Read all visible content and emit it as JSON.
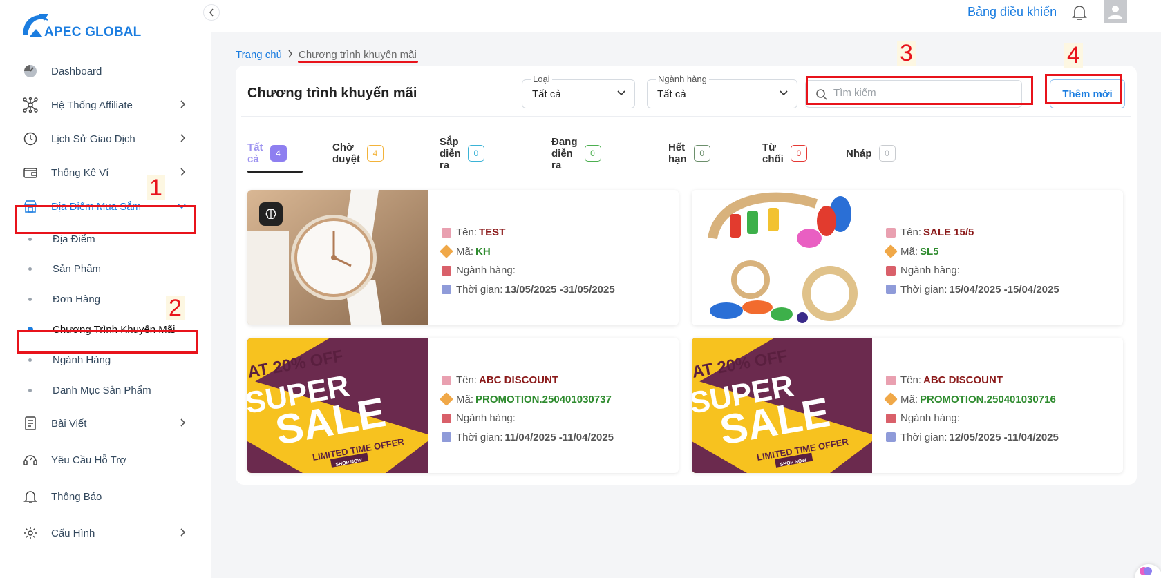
{
  "brand": {
    "name": "APEC GLOBAL"
  },
  "sidebar": {
    "items": [
      {
        "label": "Dashboard",
        "icon": "gauge-icon"
      },
      {
        "label": "Hệ Thống Affiliate",
        "icon": "network-icon"
      },
      {
        "label": "Lịch Sử Giao Dịch",
        "icon": "history-icon"
      },
      {
        "label": "Thống Kê Ví",
        "icon": "wallet-icon"
      },
      {
        "label": "Địa Điểm Mua Sắm",
        "icon": "store-icon"
      },
      {
        "label": "Bài Viết",
        "icon": "article-icon"
      },
      {
        "label": "Yêu Cầu Hỗ Trợ",
        "icon": "support-icon"
      },
      {
        "label": "Thông Báo",
        "icon": "bell-icon"
      },
      {
        "label": "Cấu Hình",
        "icon": "gear-icon"
      }
    ],
    "subitems": [
      {
        "label": "Địa Điểm"
      },
      {
        "label": "Sản Phẩm"
      },
      {
        "label": "Đơn Hàng"
      },
      {
        "label": "Chương Trình Khuyến Mãi"
      },
      {
        "label": "Ngành Hàng"
      },
      {
        "label": "Danh Mục Sản Phẩm"
      }
    ]
  },
  "annotations": {
    "n1": "1",
    "n2": "2",
    "n3": "3",
    "n4": "4"
  },
  "topbar": {
    "dashboard_link": "Bảng điều khiển"
  },
  "breadcrumb": {
    "home": "Trang chủ",
    "current": "Chương trình khuyến mãi"
  },
  "main": {
    "title": "Chương trình khuyến mãi",
    "filter_type": {
      "label": "Loại",
      "value": "Tất cả"
    },
    "filter_category": {
      "label": "Ngành hàng",
      "value": "Tất cả"
    },
    "search": {
      "placeholder": "Tìm kiếm"
    },
    "add_button": "Thêm mới",
    "tabs": [
      {
        "label": "Tất cả",
        "count": "4",
        "color": "#8e7ff0"
      },
      {
        "label": "Chờ duyệt",
        "count": "4",
        "color": "#f3b33a"
      },
      {
        "label": "Sắp diễn ra",
        "count": "0",
        "color": "#3bb3d6"
      },
      {
        "label": "Đang diễn ra",
        "count": "0",
        "color": "#4caf50"
      },
      {
        "label": "Hết hạn",
        "count": "0",
        "color": "#6c8f6c"
      },
      {
        "label": "Từ chối",
        "count": "0",
        "color": "#e53935"
      },
      {
        "label": "Nháp",
        "count": "0",
        "color": "#b0b4b9"
      }
    ],
    "field_labels": {
      "name": "Tên:",
      "code": "Mã:",
      "category": "Ngành hàng:",
      "time": "Thời gian:"
    },
    "cards": [
      {
        "name": "TEST",
        "code": "KH",
        "time": "13/05/2025 -31/05/2025",
        "image": "watch"
      },
      {
        "name": "SALE 15/5",
        "code": "SL5",
        "time": "15/04/2025 -15/04/2025",
        "image": "toys"
      },
      {
        "name": "ABC DISCOUNT",
        "code": "PROMOTION.250401030737",
        "time": "11/04/2025 -11/04/2025",
        "image": "super-sale"
      },
      {
        "name": "ABC DISCOUNT",
        "code": "PROMOTION.250401030716",
        "time": "12/05/2025 -11/04/2025",
        "image": "super-sale"
      }
    ],
    "sale_banner": {
      "line1": "AT 20% OFF",
      "line2": "SUPER",
      "line3": "SALE",
      "line4": "LIMITED TIME OFFER",
      "line5": "SHOP NOW"
    }
  },
  "colors": {
    "accent": "#1b7de0",
    "highlight": "#e8131b"
  }
}
